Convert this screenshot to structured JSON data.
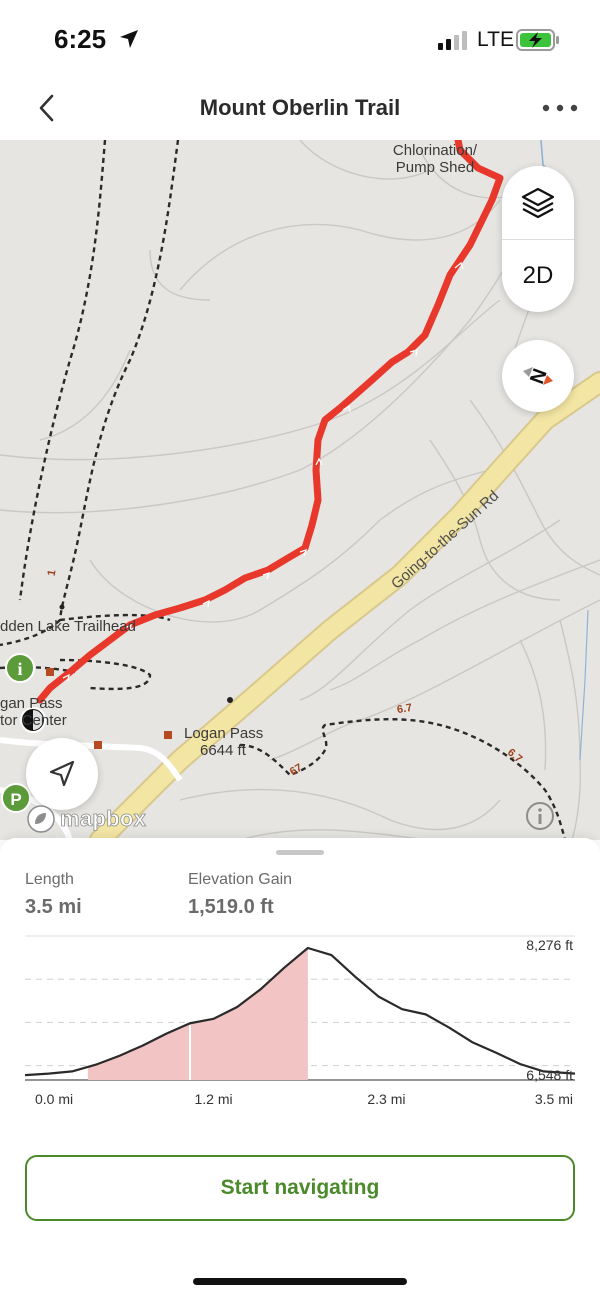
{
  "status": {
    "time": "6:25",
    "network": "LTE"
  },
  "nav": {
    "title": "Mount Oberlin Trail"
  },
  "map": {
    "labels": {
      "chlorination_line1": "Chlorination/",
      "chlorination_line2": "Pump Shed",
      "trailhead": "dden Lake Trailhead",
      "visitor_line1": "gan Pass",
      "visitor_line2": "tor Center",
      "logan_pass": "Logan Pass",
      "logan_pass_elev": "6644 ft",
      "road": "Going-to-the-Sun Rd",
      "trail_num_1": "1",
      "trail_num_67a": "6.7",
      "trail_num_67b": "6.7",
      "trail_num_67c": "67"
    },
    "controls": {
      "mode_2d": "2D"
    },
    "attribution": "mapbox",
    "route_color": "#e8372b"
  },
  "stats": {
    "length_label": "Length",
    "length_value": "3.5 mi",
    "gain_label": "Elevation Gain",
    "gain_value": "1,519.0 ft"
  },
  "chart_data": {
    "type": "area",
    "title": "",
    "xlabel": "",
    "ylabel": "",
    "x_ticks": [
      "0.0 mi",
      "1.2 mi",
      "2.3 mi",
      "3.5 mi"
    ],
    "y_ticks": [
      "8,276 ft",
      "6,548 ft"
    ],
    "x_range": [
      0,
      3.5
    ],
    "y_range": [
      6548,
      8276
    ],
    "x": [
      0,
      0.15,
      0.3,
      0.45,
      0.6,
      0.75,
      0.9,
      1.05,
      1.2,
      1.35,
      1.5,
      1.65,
      1.8,
      1.95,
      2.1,
      2.25,
      2.4,
      2.55,
      2.7,
      2.85,
      3.0,
      3.15,
      3.3,
      3.5
    ],
    "y": [
      6560,
      6580,
      6610,
      6700,
      6820,
      6960,
      7120,
      7260,
      7320,
      7480,
      7720,
      8010,
      8276,
      8180,
      7890,
      7620,
      7450,
      7380,
      7200,
      7000,
      6860,
      6710,
      6610,
      6580
    ],
    "highlight_range": [
      0.4,
      1.8
    ],
    "marker_x": 1.05,
    "fill_color": "#f2c4c4",
    "line_color": "#2a2a2a"
  },
  "actions": {
    "start_label": "Start navigating"
  }
}
